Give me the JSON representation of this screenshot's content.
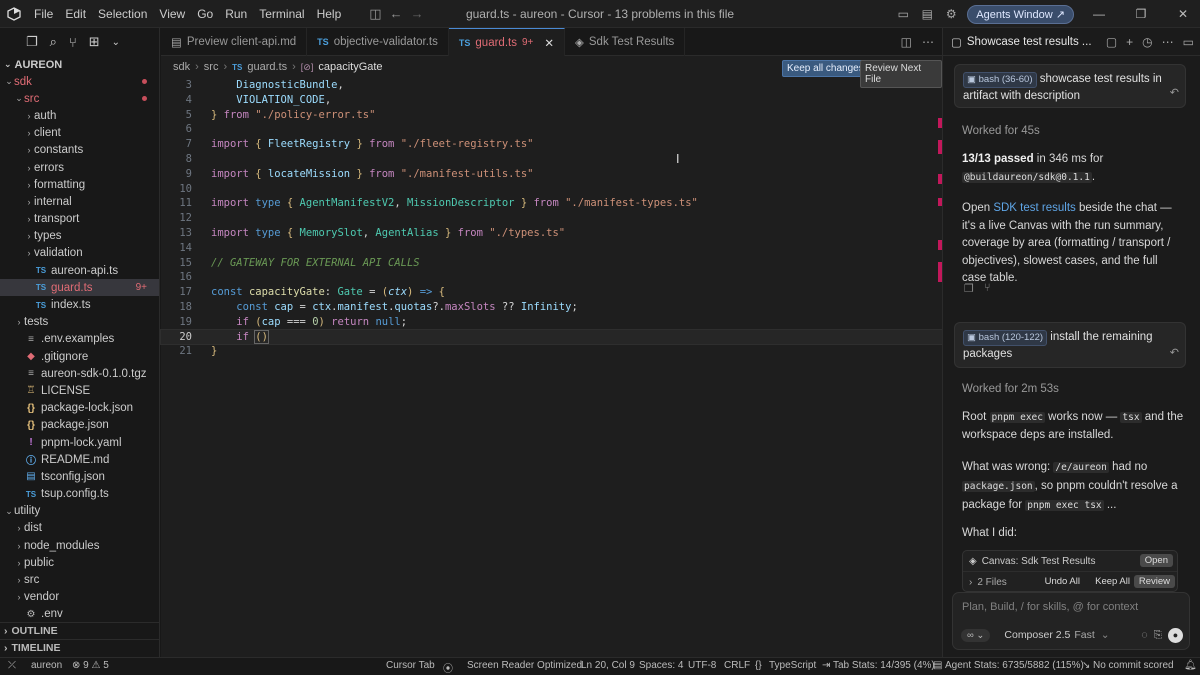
{
  "window": {
    "title": "guard.ts - aureon - Cursor - 13 problems in this file",
    "menus": [
      "File",
      "Edit",
      "Selection",
      "View",
      "Go",
      "Run",
      "Terminal",
      "Help"
    ],
    "agents_window": "Agents Window"
  },
  "explorer": {
    "root": "AUREON",
    "tree": [
      {
        "label": "sdk",
        "depth": 0,
        "type": "folder",
        "open": true,
        "error": true
      },
      {
        "label": "src",
        "depth": 1,
        "type": "folder",
        "open": true,
        "error": true
      },
      {
        "label": "auth",
        "depth": 2,
        "type": "folder"
      },
      {
        "label": "client",
        "depth": 2,
        "type": "folder"
      },
      {
        "label": "constants",
        "depth": 2,
        "type": "folder"
      },
      {
        "label": "errors",
        "depth": 2,
        "type": "folder"
      },
      {
        "label": "formatting",
        "depth": 2,
        "type": "folder"
      },
      {
        "label": "internal",
        "depth": 2,
        "type": "folder"
      },
      {
        "label": "transport",
        "depth": 2,
        "type": "folder"
      },
      {
        "label": "types",
        "depth": 2,
        "type": "folder"
      },
      {
        "label": "validation",
        "depth": 2,
        "type": "folder"
      },
      {
        "label": "aureon-api.ts",
        "depth": 2,
        "type": "ts"
      },
      {
        "label": "guard.ts",
        "depth": 2,
        "type": "ts",
        "selected": true,
        "badge": "9+"
      },
      {
        "label": "index.ts",
        "depth": 2,
        "type": "ts"
      },
      {
        "label": "tests",
        "depth": 1,
        "type": "folder"
      },
      {
        "label": ".env.examples",
        "depth": 1,
        "type": "env"
      },
      {
        "label": ".gitignore",
        "depth": 1,
        "type": "git"
      },
      {
        "label": "aureon-sdk-0.1.0.tgz",
        "depth": 1,
        "type": "file"
      },
      {
        "label": "LICENSE",
        "depth": 1,
        "type": "license"
      },
      {
        "label": "package-lock.json",
        "depth": 1,
        "type": "json"
      },
      {
        "label": "package.json",
        "depth": 1,
        "type": "json"
      },
      {
        "label": "pnpm-lock.yaml",
        "depth": 1,
        "type": "yaml"
      },
      {
        "label": "README.md",
        "depth": 1,
        "type": "md"
      },
      {
        "label": "tsconfig.json",
        "depth": 1,
        "type": "tsconfig"
      },
      {
        "label": "tsup.config.ts",
        "depth": 1,
        "type": "ts"
      },
      {
        "label": "utility",
        "depth": 0,
        "type": "folder",
        "open": true
      },
      {
        "label": "dist",
        "depth": 1,
        "type": "folder"
      },
      {
        "label": "node_modules",
        "depth": 1,
        "type": "folder"
      },
      {
        "label": "public",
        "depth": 1,
        "type": "folder"
      },
      {
        "label": "src",
        "depth": 1,
        "type": "folder"
      },
      {
        "label": "vendor",
        "depth": 1,
        "type": "folder"
      },
      {
        "label": ".env",
        "depth": 1,
        "type": "gear"
      }
    ],
    "outline": "OUTLINE",
    "timeline": "TIMELINE"
  },
  "tabs": [
    {
      "label": "Preview client-api.md",
      "icon": "preview",
      "active": false
    },
    {
      "label": "objective-validator.ts",
      "icon": "ts",
      "active": false
    },
    {
      "label": "guard.ts",
      "icon": "ts",
      "active": true,
      "count": "9+"
    },
    {
      "label": "Sdk Test Results",
      "icon": "canvas",
      "active": false
    }
  ],
  "breadcrumb": [
    "sdk",
    "src",
    "guard.ts",
    "capacityGate"
  ],
  "review": {
    "keep_all": "Keep all changes",
    "review_next": "Review Next File"
  },
  "code_lines": [
    {
      "n": "3",
      "html": "    <span class='id'>DiagnosticBundle</span><span class='pl'>,</span>"
    },
    {
      "n": "4",
      "html": "    <span class='id'>VIOLATION_CODE</span><span class='pl'>,</span>"
    },
    {
      "n": "5",
      "html": "<span class='br'>}</span> <span class='kw'>from</span> <span class='str'>\"./policy-error.ts\"</span>"
    },
    {
      "n": "6",
      "html": ""
    },
    {
      "n": "7",
      "html": "<span class='kw'>import</span> <span class='br'>{</span> <span class='id'>FleetRegistry</span> <span class='br'>}</span> <span class='kw'>from</span> <span class='str'>\"./fleet-registry.ts\"</span>"
    },
    {
      "n": "8",
      "html": ""
    },
    {
      "n": "9",
      "html": "<span class='kw'>import</span> <span class='br'>{</span> <span class='id'>locateMission</span> <span class='br'>}</span> <span class='kw'>from</span> <span class='str'>\"./manifest-utils.ts\"</span>"
    },
    {
      "n": "10",
      "html": ""
    },
    {
      "n": "11",
      "html": "<span class='kw'>import</span> <span class='kwb'>type</span> <span class='br'>{</span> <span class='ty'>AgentManifestV2</span><span class='pl'>,</span> <span class='ty'>MissionDescriptor</span> <span class='br'>}</span> <span class='kw'>from</span> <span class='str'>\"./manifest-types.ts\"</span>"
    },
    {
      "n": "12",
      "html": ""
    },
    {
      "n": "13",
      "html": "<span class='kw'>import</span> <span class='kwb'>type</span> <span class='br'>{</span> <span class='ty'>MemorySlot</span><span class='pl'>,</span> <span class='ty'>AgentAlias</span> <span class='br'>}</span> <span class='kw'>from</span> <span class='str'>\"./types.ts\"</span>"
    },
    {
      "n": "14",
      "html": ""
    },
    {
      "n": "15",
      "html": "<span class='cm'>// GATEWAY FOR EXTERNAL API CALLS</span>"
    },
    {
      "n": "16",
      "html": ""
    },
    {
      "n": "17",
      "html": "<span class='kwb'>const</span> <span class='fn'>capacityGate</span><span class='pl'>:</span> <span class='ty'>Gate</span> <span class='pl'>=</span> <span class='br'>(</span><span class='id' style='font-style:italic'>ctx</span><span class='br'>)</span> <span class='kwb'>=&gt;</span> <span class='br'>{</span>"
    },
    {
      "n": "18",
      "html": "    <span class='kwb'>const</span> <span class='id'>cap</span> <span class='pl'>=</span> <span class='id'>ctx</span><span class='pl'>.</span><span class='id'>manifest</span><span class='pl'>.</span><span class='id'>quotas</span><span class='pl'>?.</span><span class='pr'>maxSlots</span> <span class='pl'>??</span> <span class='id'>Infinity</span><span class='pl'>;</span>"
    },
    {
      "n": "19",
      "html": "    <span class='kw'>if</span> <span class='br'>(</span><span class='id'>cap</span> <span class='pl'>===</span> <span class='num'>0</span><span class='br'>)</span> <span class='kw'>return</span> <span class='kwb'>null</span><span class='pl'>;</span>"
    },
    {
      "n": "20",
      "html": "    <span class='kw'>if</span> <span class='br' style='outline:1px solid #666'>()</span>",
      "current": true
    },
    {
      "n": "21",
      "html": "<span class='br'>}</span>"
    }
  ],
  "chat": {
    "header": "Showcase test results ...",
    "msg1_pill": "bash (36-60)",
    "msg1_text": "showcase test results in artifact with description",
    "worked1": "Worked for 45s",
    "passed": "13/13 passed",
    "passed_rest": " in 346 ms for",
    "pkg": "@buildaureon/sdk@0.1.1",
    "open_pre": "Open ",
    "open_link": "SDK test results",
    "open_rest": " beside the chat — it's a live Canvas with the run summary, coverage by area (formatting / transport / objectives), slowest cases, and the full case table.",
    "msg2_pill": "bash (120-122)",
    "msg2_text": "install the remaining packages",
    "worked2": "Worked for 2m 53s",
    "root_pre": "Root ",
    "root_code": "pnpm exec",
    "root_mid": " works now — ",
    "root_code2": "tsx",
    "root_rest": " and the workspace deps are installed.",
    "wrong_pre": "What was wrong: ",
    "wrong_code": "/e/aureon",
    "wrong_mid": " had no ",
    "wrong_code2": "package.json",
    "wrong_mid2": ", so pnpm couldn't resolve a package for ",
    "wrong_code3": "pnpm exec tsx",
    "wrong_end": " ...",
    "what_i_did": "What I did:",
    "canvas_label": "Canvas: Sdk Test Results",
    "canvas_open": "Open",
    "files": "2 Files",
    "undo_all": "Undo All",
    "keep_all": "Keep All",
    "review": "Review",
    "composer_placeholder": "Plan, Build, / for skills, @ for context",
    "mode": "∞",
    "model": "Composer 2.5",
    "speed": "Fast"
  },
  "statusbar": {
    "branch": "aureon",
    "errors": "9",
    "warnings": "5",
    "cursor_tab": "Cursor Tab",
    "screen_reader": "Screen Reader Optimized",
    "position": "Ln 20, Col 9",
    "spaces": "Spaces: 4",
    "encoding": "UTF-8",
    "eol": "CRLF",
    "language": "TypeScript",
    "tab_stats": "Tab Stats: 14/395 (4%)",
    "agent_stats": "Agent Stats: 6735/5882 (115%)",
    "commit": "No commit scored"
  }
}
